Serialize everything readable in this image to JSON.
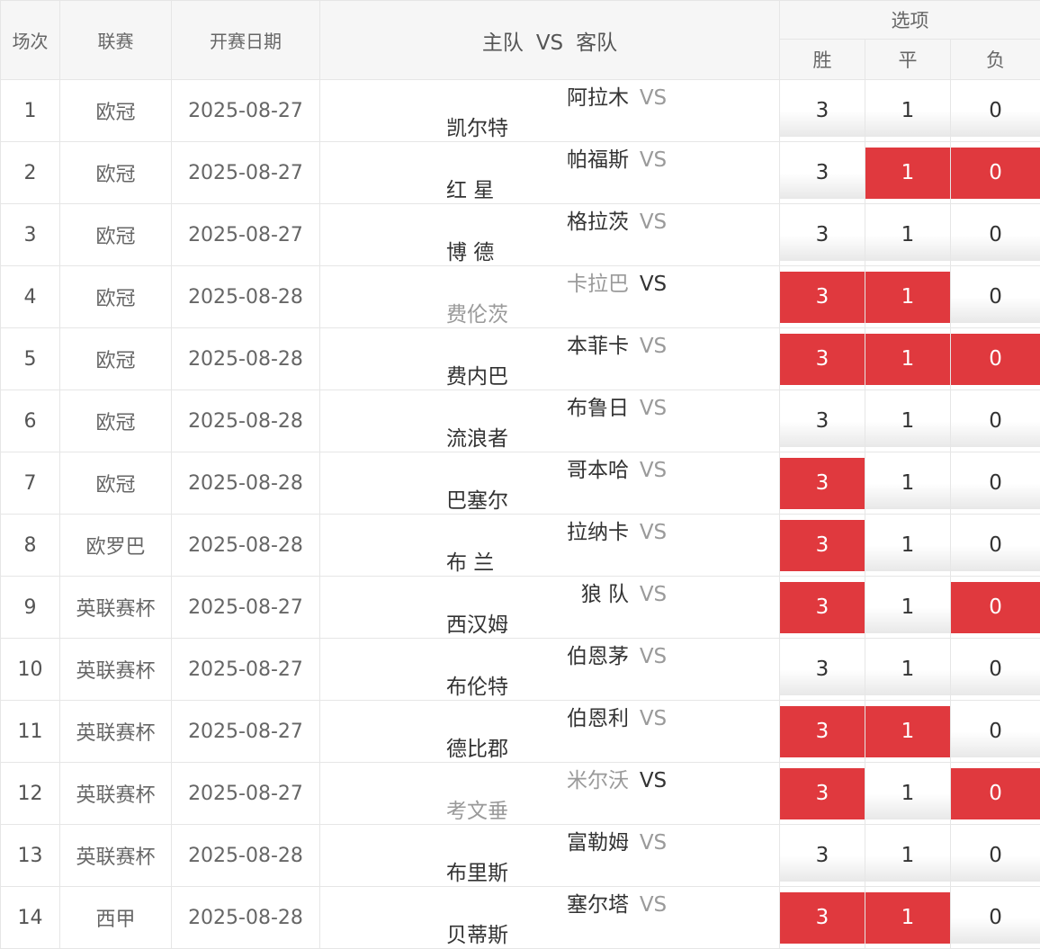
{
  "header": {
    "idx": "场次",
    "league": "联赛",
    "date": "开赛日期",
    "home": "主队",
    "vs": "VS",
    "away": "客队",
    "options": "选项",
    "win": "胜",
    "draw": "平",
    "lose": "负"
  },
  "colors": {
    "selected": "#e0393e",
    "header_bg": "#f6f6f6",
    "border": "#e6e6e6"
  },
  "rows": [
    {
      "idx": "1",
      "league": "欧冠",
      "date": "2025-08-27",
      "home": "阿拉木",
      "vs": "VS",
      "away": "凯尔特",
      "finished": false,
      "w": "3",
      "d": "1",
      "l": "0",
      "ws": false,
      "ds": false,
      "ls": false
    },
    {
      "idx": "2",
      "league": "欧冠",
      "date": "2025-08-27",
      "home": "帕福斯",
      "vs": "VS",
      "away": "红 星",
      "finished": false,
      "w": "3",
      "d": "1",
      "l": "0",
      "ws": false,
      "ds": true,
      "ls": true
    },
    {
      "idx": "3",
      "league": "欧冠",
      "date": "2025-08-27",
      "home": "格拉茨",
      "vs": "VS",
      "away": "博 德",
      "finished": false,
      "w": "3",
      "d": "1",
      "l": "0",
      "ws": false,
      "ds": false,
      "ls": false
    },
    {
      "idx": "4",
      "league": "欧冠",
      "date": "2025-08-28",
      "home": "卡拉巴",
      "vs": "VS",
      "away": "费伦茨",
      "finished": true,
      "w": "3",
      "d": "1",
      "l": "0",
      "ws": true,
      "ds": true,
      "ls": false
    },
    {
      "idx": "5",
      "league": "欧冠",
      "date": "2025-08-28",
      "home": "本菲卡",
      "vs": "VS",
      "away": "费内巴",
      "finished": false,
      "w": "3",
      "d": "1",
      "l": "0",
      "ws": true,
      "ds": true,
      "ls": true
    },
    {
      "idx": "6",
      "league": "欧冠",
      "date": "2025-08-28",
      "home": "布鲁日",
      "vs": "VS",
      "away": "流浪者",
      "finished": false,
      "w": "3",
      "d": "1",
      "l": "0",
      "ws": false,
      "ds": false,
      "ls": false
    },
    {
      "idx": "7",
      "league": "欧冠",
      "date": "2025-08-28",
      "home": "哥本哈",
      "vs": "VS",
      "away": "巴塞尔",
      "finished": false,
      "w": "3",
      "d": "1",
      "l": "0",
      "ws": true,
      "ds": false,
      "ls": false
    },
    {
      "idx": "8",
      "league": "欧罗巴",
      "date": "2025-08-28",
      "home": "拉纳卡",
      "vs": "VS",
      "away": "布 兰",
      "finished": false,
      "w": "3",
      "d": "1",
      "l": "0",
      "ws": true,
      "ds": false,
      "ls": false
    },
    {
      "idx": "9",
      "league": "英联赛杯",
      "date": "2025-08-27",
      "home": "狼 队",
      "vs": "VS",
      "away": "西汉姆",
      "finished": false,
      "w": "3",
      "d": "1",
      "l": "0",
      "ws": true,
      "ds": false,
      "ls": true
    },
    {
      "idx": "10",
      "league": "英联赛杯",
      "date": "2025-08-27",
      "home": "伯恩茅",
      "vs": "VS",
      "away": "布伦特",
      "finished": false,
      "w": "3",
      "d": "1",
      "l": "0",
      "ws": false,
      "ds": false,
      "ls": false
    },
    {
      "idx": "11",
      "league": "英联赛杯",
      "date": "2025-08-27",
      "home": "伯恩利",
      "vs": "VS",
      "away": "德比郡",
      "finished": false,
      "w": "3",
      "d": "1",
      "l": "0",
      "ws": true,
      "ds": true,
      "ls": false
    },
    {
      "idx": "12",
      "league": "英联赛杯",
      "date": "2025-08-27",
      "home": "米尔沃",
      "vs": "VS",
      "away": "考文垂",
      "finished": true,
      "w": "3",
      "d": "1",
      "l": "0",
      "ws": true,
      "ds": false,
      "ls": true
    },
    {
      "idx": "13",
      "league": "英联赛杯",
      "date": "2025-08-28",
      "home": "富勒姆",
      "vs": "VS",
      "away": "布里斯",
      "finished": false,
      "w": "3",
      "d": "1",
      "l": "0",
      "ws": false,
      "ds": false,
      "ls": false
    },
    {
      "idx": "14",
      "league": "西甲",
      "date": "2025-08-28",
      "home": "塞尔塔",
      "vs": "VS",
      "away": "贝蒂斯",
      "finished": false,
      "w": "3",
      "d": "1",
      "l": "0",
      "ws": true,
      "ds": true,
      "ls": false
    }
  ]
}
